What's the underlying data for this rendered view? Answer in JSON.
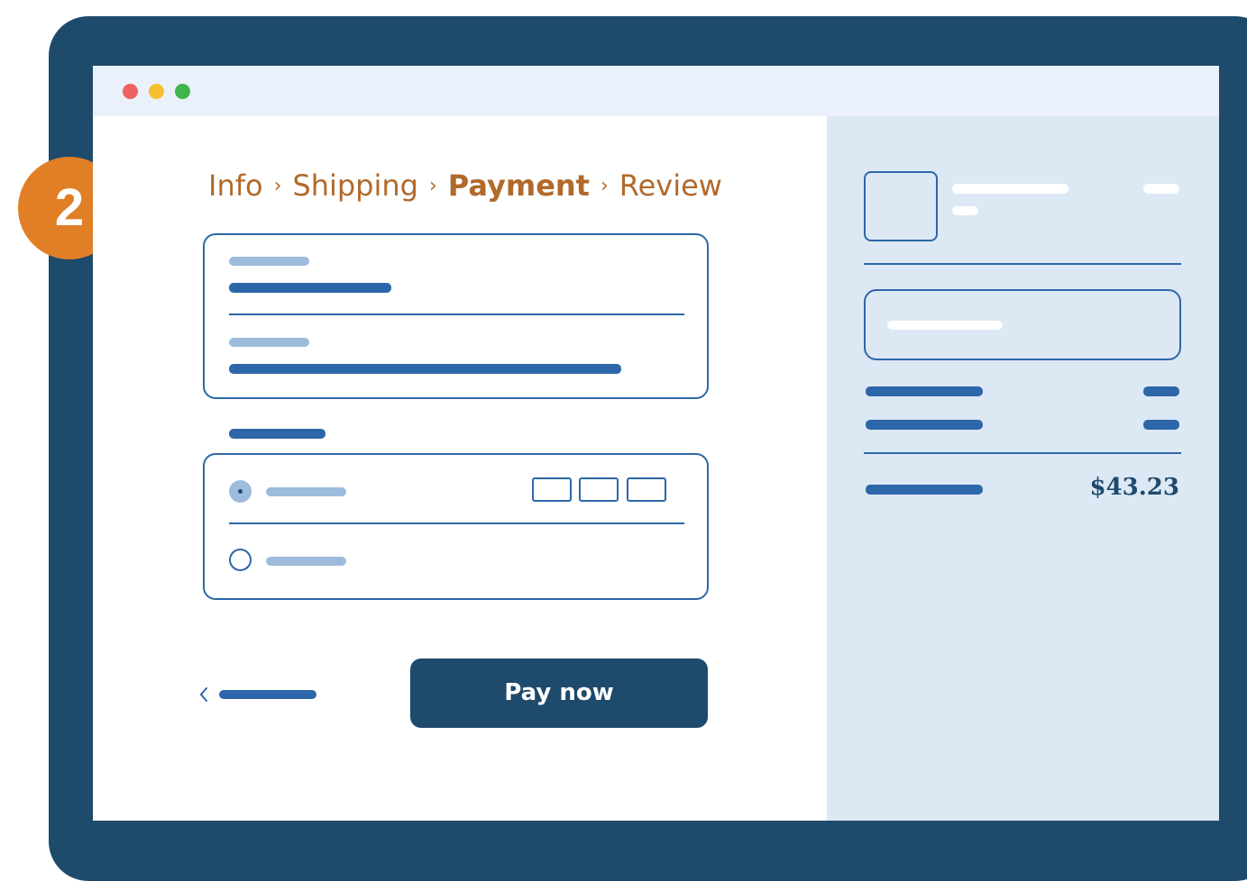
{
  "window": {
    "dots": {
      "close": "#ee6264",
      "minimize": "#f5c02f",
      "maximize": "#3fb54c"
    }
  },
  "step_badge": {
    "number": "2",
    "color": "#e07f26"
  },
  "breadcrumb": {
    "items": [
      {
        "label": "Info",
        "current": false
      },
      {
        "label": "Shipping",
        "current": false
      },
      {
        "label": "Payment",
        "current": true
      },
      {
        "label": "Review",
        "current": false
      }
    ],
    "separator": "›"
  },
  "payment_methods": {
    "options": [
      {
        "selected": true,
        "card_icons": 3
      },
      {
        "selected": false
      }
    ]
  },
  "actions": {
    "pay_label": "Pay now",
    "back_icon": "chevron-left-icon"
  },
  "summary": {
    "total": "$43.23"
  },
  "colors": {
    "frame": "#1e4a6c",
    "accent": "#b06a2c",
    "line": "#2d67a9",
    "placeholder": "#9dbcdc",
    "sidebar": "#dde8f5"
  }
}
